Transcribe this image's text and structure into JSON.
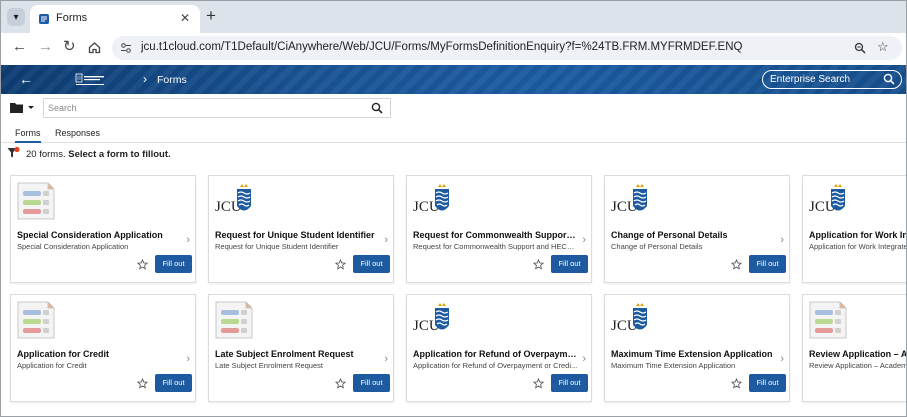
{
  "browser": {
    "tab_title": "Forms",
    "tab_close": "✕",
    "new_tab": "+",
    "url": "jcu.t1cloud.com/T1Default/CiAnywhere/Web/JCU/Forms/MyFormsDefinitionEnquiry?f=%24TB.FRM.MYFRMDEF.ENQ"
  },
  "app": {
    "breadcrumb": "Forms",
    "enterprise_search": "Enterprise Search",
    "search_placeholder": "Search",
    "brand_color": "#1b5ca3"
  },
  "subtabs": [
    {
      "label": "Forms",
      "active": true
    },
    {
      "label": "Responses",
      "active": false
    }
  ],
  "summary": {
    "count": "20 forms.",
    "instruction": "Select a form to fillout."
  },
  "cards": [
    {
      "title": "Special Consideration Application",
      "desc": "Special Consideration Application",
      "icon": "form-icon",
      "button": "Fill out"
    },
    {
      "title": "Request for Unique Student Identifier",
      "desc": "Request for Unique Student Identifier",
      "icon": "jcu-logo",
      "button": "Fill out"
    },
    {
      "title": "Request for Commonwealth Support ...",
      "desc": "Request for Commonwealth Support and HECS-...",
      "icon": "jcu-logo",
      "button": "Fill out"
    },
    {
      "title": "Change of Personal Details",
      "desc": "Change of Personal Details",
      "icon": "jcu-logo",
      "button": "Fill out"
    },
    {
      "title": "Application for Work Integ",
      "desc": "Application for Work Integrated",
      "icon": "jcu-logo",
      "button": "Fill out"
    },
    {
      "title": "Application for Credit",
      "desc": "Application for Credit",
      "icon": "form-icon",
      "button": "Fill out"
    },
    {
      "title": "Late Subject Enrolment Request",
      "desc": "Late Subject Enrolment Request",
      "icon": "form-icon",
      "button": "Fill out"
    },
    {
      "title": "Application for Refund of Overpayme...",
      "desc": "Application for Refund of Overpayment or Credi...",
      "icon": "jcu-logo",
      "button": "Fill out"
    },
    {
      "title": "Maximum Time Extension Application",
      "desc": "Maximum Time Extension Application",
      "icon": "jcu-logo",
      "button": "Fill out"
    },
    {
      "title": "Review Application – Aca",
      "desc": "Review Application – Academic",
      "icon": "form-icon",
      "button": "Fill out"
    }
  ]
}
